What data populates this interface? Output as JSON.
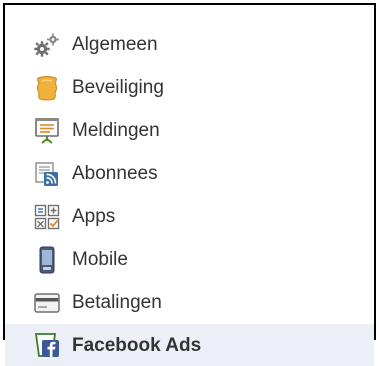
{
  "menu": {
    "items": [
      {
        "label": "Algemeen",
        "icon": "gears-icon"
      },
      {
        "label": "Beveiliging",
        "icon": "shield-icon"
      },
      {
        "label": "Meldingen",
        "icon": "presentation-icon"
      },
      {
        "label": "Abonnees",
        "icon": "rss-feed-icon"
      },
      {
        "label": "Apps",
        "icon": "apps-icon"
      },
      {
        "label": "Mobile",
        "icon": "mobile-phone-icon"
      },
      {
        "label": "Betalingen",
        "icon": "credit-card-icon"
      },
      {
        "label": "Facebook Ads",
        "icon": "facebook-ads-icon",
        "active": true
      }
    ]
  },
  "colors": {
    "active_background": "#eceff5",
    "text": "#333333",
    "border": "#000000",
    "facebook_blue": "#3b5998",
    "shield_orange": "#f0b13c",
    "icon_gray": "#707070"
  }
}
